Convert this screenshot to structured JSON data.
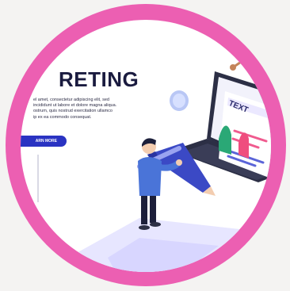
{
  "hero": {
    "title": "RETING",
    "body_lines": [
      "el amet, consectetur adipiscing elit, sed",
      "incididunt ut labore et dolore magna aliqua.",
      "ostrum, quis nostrud exercitation ullamco",
      "ip ex ea commodo consequat."
    ],
    "button_label": "ARN MORE"
  },
  "document": {
    "label": "TEXT"
  },
  "colors": {
    "ring": "#ec5fb2",
    "accent": "#2a33c2",
    "title": "#1a1b3f"
  }
}
